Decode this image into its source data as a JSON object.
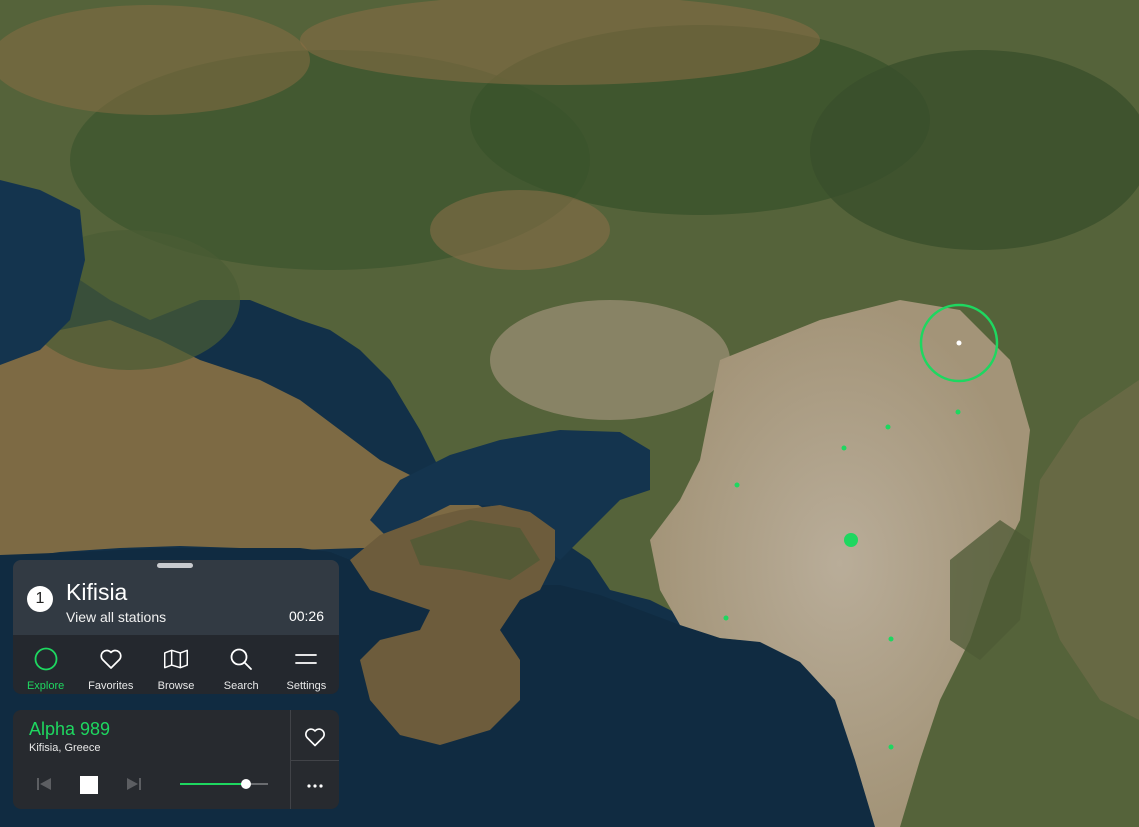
{
  "station_panel": {
    "station_count": "1",
    "place_name": "Kifisia",
    "view_all_label": "View all stations",
    "local_time": "00:26"
  },
  "nav": {
    "active": "explore",
    "items": [
      {
        "id": "explore",
        "label": "Explore",
        "icon": "circle-icon"
      },
      {
        "id": "favorites",
        "label": "Favorites",
        "icon": "heart-icon"
      },
      {
        "id": "browse",
        "label": "Browse",
        "icon": "map-icon"
      },
      {
        "id": "search",
        "label": "Search",
        "icon": "search-icon"
      },
      {
        "id": "settings",
        "label": "Settings",
        "icon": "menu-icon"
      }
    ]
  },
  "player": {
    "station_name": "Alpha 989",
    "station_location": "Kifisia, Greece",
    "volume_fraction": 0.75,
    "state": "playing"
  },
  "colors": {
    "accent": "#1ed760",
    "sea": "#0f2a3e",
    "land": "#8b7a55"
  }
}
